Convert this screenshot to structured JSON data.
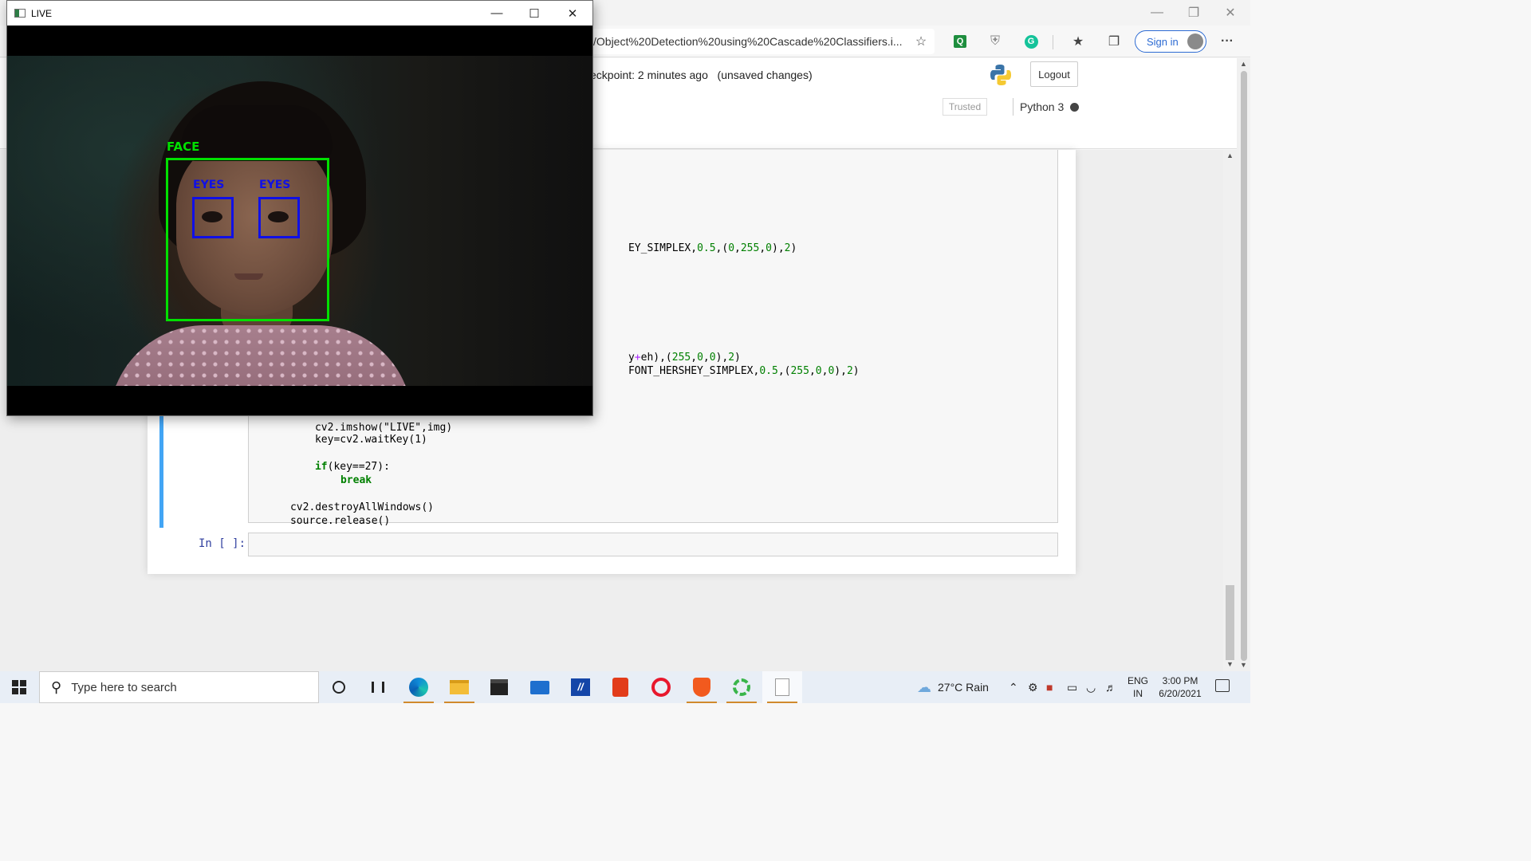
{
  "browser": {
    "address": "/Object%20Detection%20using%20Cascade%20Classifiers.i...",
    "signin_label": "Sign in",
    "more_label": "···"
  },
  "jupyter": {
    "checkpoint": "eckpoint: 2 minutes ago",
    "unsaved": "(unsaved changes)",
    "logout_label": "Logout",
    "trusted_label": "Trusted",
    "kernel_name": "Python 3",
    "empty_prompt": "In [ ]:"
  },
  "code": {
    "line1_visible": "EY_SIMPLEX,0.5,(0,255,0),2)",
    "line2_visible": "y+eh),(255,0,0),2)",
    "line3_visible": "FONT_HERSHEY_SIMPLEX,0.5,(255,0,0),2)",
    "line4_partial": "cv2.imshow(\"LIVE\",img)",
    "line5": "key=cv2.waitKey(1)",
    "line6_kw": "if",
    "line6_rest": "(key==27):",
    "line7_kw": "break",
    "line8": "cv2.destroyAllWindows()",
    "line9": "source.release()"
  },
  "live_window": {
    "title": "LIVE",
    "face_label": "FACE",
    "eye_label": "EYES",
    "colors": {
      "face_box": "#00e000",
      "eye_box": "#1010e6"
    }
  },
  "taskbar": {
    "search_placeholder": "Type here to search",
    "weather": "27°C  Rain",
    "lang_top": "ENG",
    "lang_bottom": "IN",
    "time": "3:00 PM",
    "date": "6/20/2021"
  },
  "icons": {
    "start": "windows-icon",
    "cortana": "circle-icon",
    "taskview": "task-view-icon",
    "apps": [
      "edge-icon",
      "file-explorer-icon",
      "store-icon",
      "mail-icon",
      "app-icon",
      "office-icon",
      "opera-icon",
      "brave-icon",
      "green-app-icon",
      "file-icon"
    ]
  }
}
